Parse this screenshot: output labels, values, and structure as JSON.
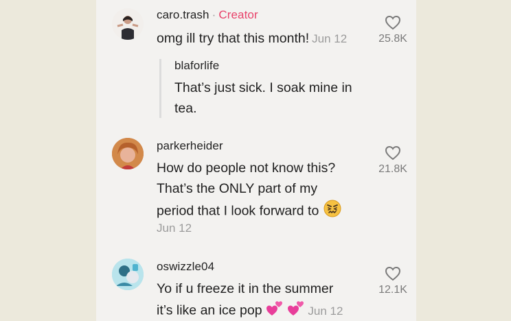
{
  "comments": [
    {
      "username": "caro.trash",
      "badge": "Creator",
      "text": "omg ill try that this month!",
      "date": "Jun 12",
      "likes": "25.8K",
      "reply": {
        "username": "blaforlife",
        "text_line1": "That’s just sick. I soak mine in",
        "text_line2": "tea."
      }
    },
    {
      "username": "parkerheider",
      "text_line1": "How do people not know this?",
      "text_line2": "That’s the ONLY part of my",
      "text_line3": "period that I look forward to",
      "date": "Jun 12",
      "likes": "21.8K"
    },
    {
      "username": "oswizzle04",
      "text_line1": "Yo if u freeze it in the summer",
      "text_line2": "it’s like an ice pop",
      "date": "Jun 12",
      "likes": "12.1K"
    }
  ],
  "icons": {
    "like": "heart-outline-icon",
    "emoji_confounded": "confounded-face-emoji",
    "emoji_hearts": "two-hearts-emoji"
  },
  "colors": {
    "creator_badge": "#e8426a",
    "date": "#9b9b9b"
  }
}
